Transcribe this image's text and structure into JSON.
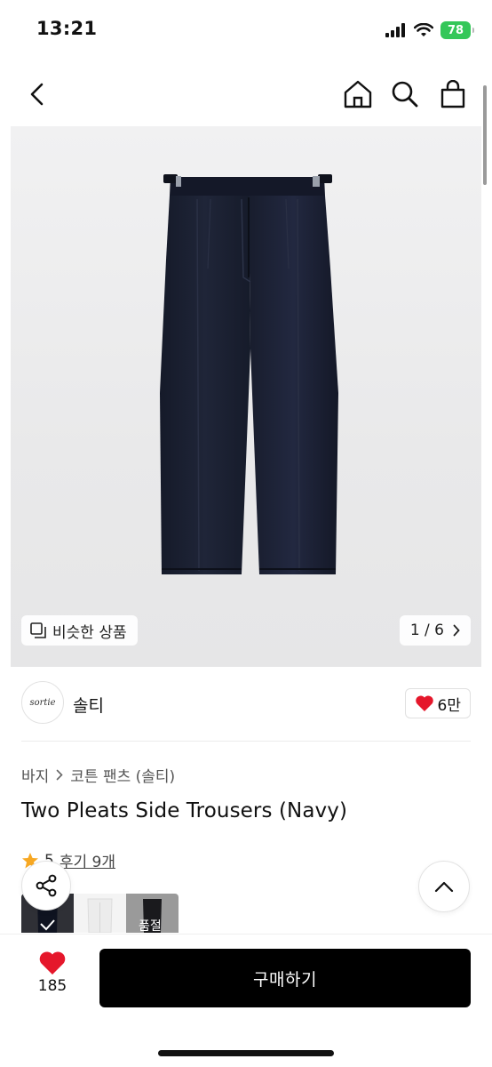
{
  "status_bar": {
    "time": "13:21",
    "battery": "78"
  },
  "nav": {
    "back": "chevron-left-icon",
    "home": "home-icon",
    "search": "search-icon",
    "cart": "shopping-bag-icon"
  },
  "hero": {
    "similar_label": "비슷한 상품",
    "page_indicator": "1 / 6"
  },
  "brand": {
    "logo_text": "sortie",
    "name": "솔티",
    "likes": "6만"
  },
  "breadcrumb": {
    "category": "바지",
    "subcategory": "코튼 팬츠 (솔티)"
  },
  "product": {
    "title": "Two Pleats Side Trousers (Navy)",
    "rating": "5",
    "reviews": "후기 9개",
    "swatches": [
      {
        "color": "#2f3036",
        "selected": true
      },
      {
        "color": "#f4f4f4",
        "selected": false
      },
      {
        "color": "#1f1f22",
        "label": "품절"
      }
    ]
  },
  "bottom": {
    "wish_count": "185",
    "buy_label": "구매하기"
  },
  "colors": {
    "heart": "#e5172b",
    "star": "#f7a823",
    "navy": "#1e2233"
  }
}
